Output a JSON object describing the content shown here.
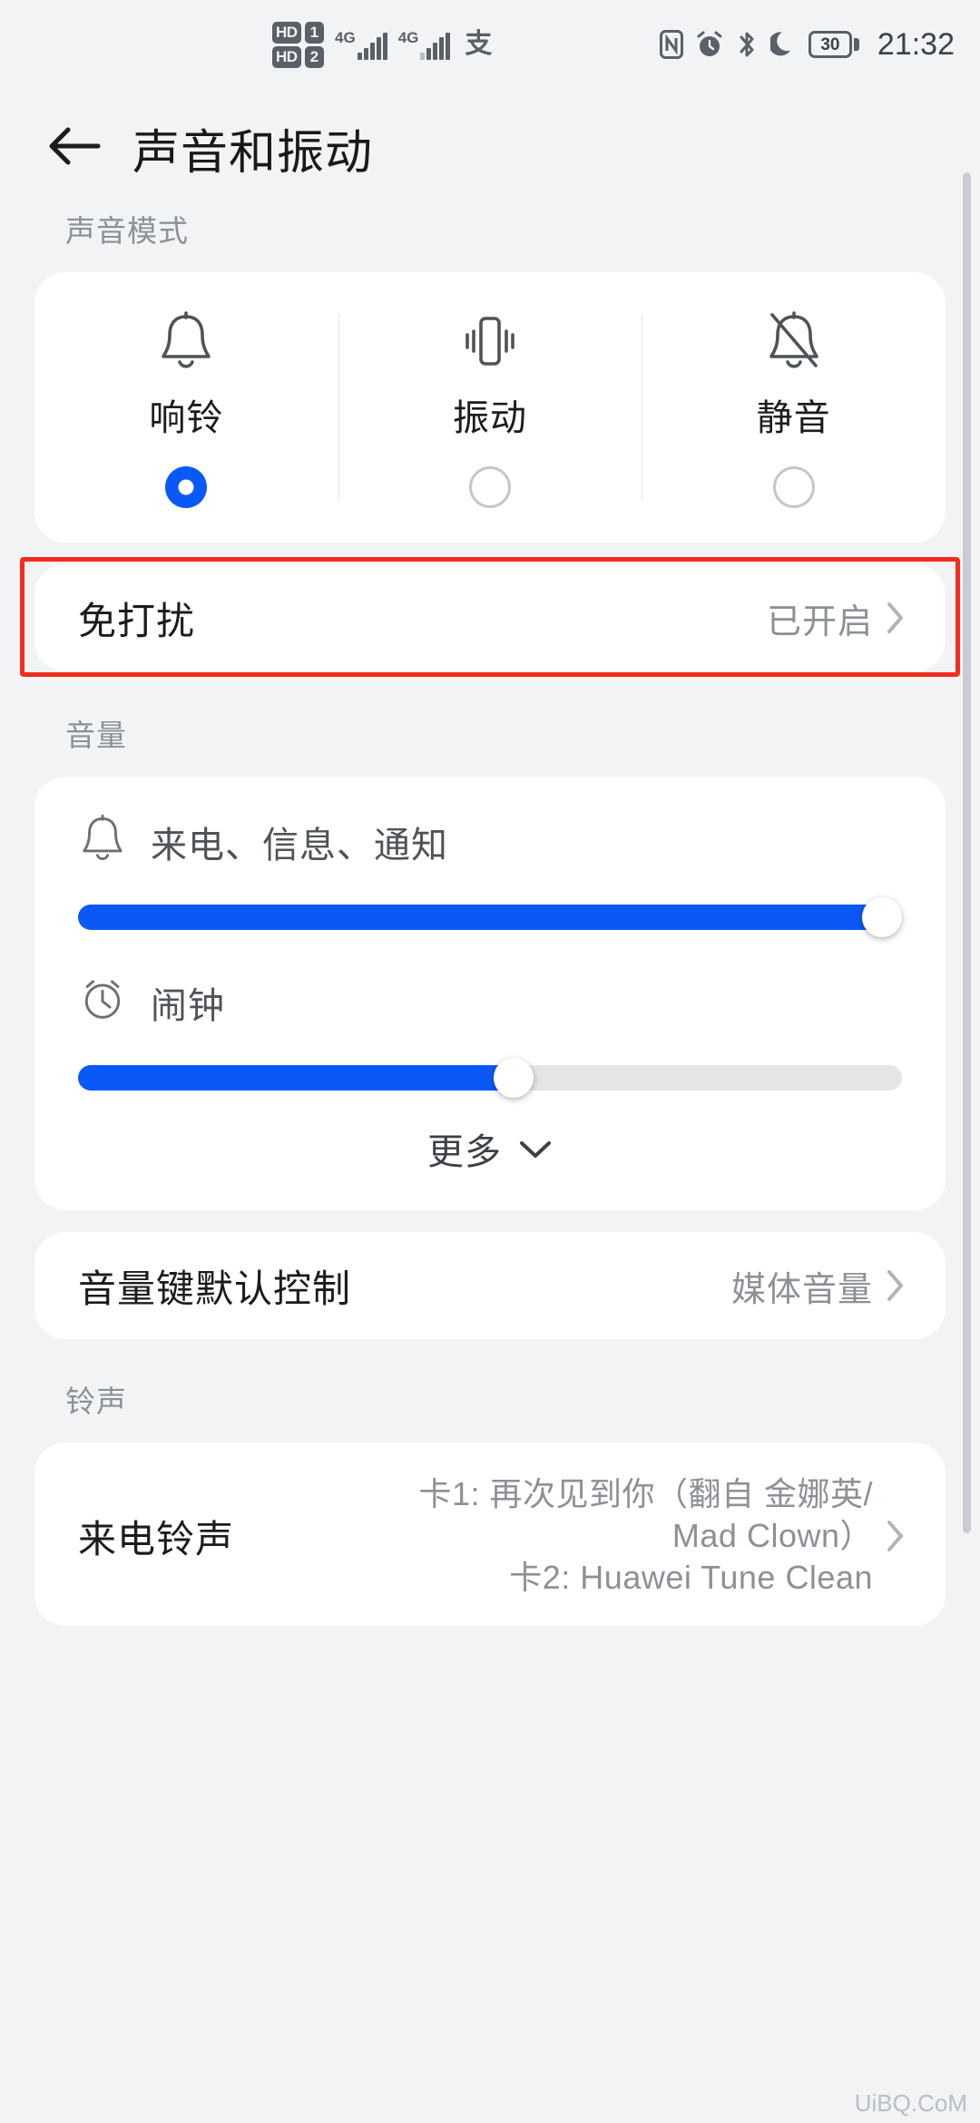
{
  "statusbar": {
    "hd1_label": "HD",
    "hd1_num": "1",
    "hd2_label": "HD",
    "hd2_num": "2",
    "network1": "4G",
    "network2": "4G",
    "alipay_glyph": "支",
    "battery_percent": "30",
    "time": "21:32",
    "icons": [
      "nfc-icon",
      "alarm-icon",
      "bluetooth-icon",
      "moon-icon",
      "battery-icon"
    ]
  },
  "header": {
    "back_icon": "back-arrow-icon",
    "title": "声音和振动"
  },
  "sound_mode": {
    "section_label": "声音模式",
    "options": [
      {
        "label": "响铃",
        "icon": "bell-icon",
        "selected": true
      },
      {
        "label": "振动",
        "icon": "vibrate-icon",
        "selected": false
      },
      {
        "label": "静音",
        "icon": "bell-muted-icon",
        "selected": false
      }
    ]
  },
  "dnd": {
    "title": "免打扰",
    "value": "已开启",
    "highlighted": true,
    "highlight_color": "#f42c1e"
  },
  "volume": {
    "section_label": "音量",
    "sliders": [
      {
        "label": "来电、信息、通知",
        "icon": "bell-icon",
        "percent": 100
      },
      {
        "label": "闹钟",
        "icon": "alarm-clock-icon",
        "percent": 53
      }
    ],
    "more_label": "更多",
    "more_icon": "chevron-down-icon"
  },
  "volume_key": {
    "title": "音量键默认控制",
    "value": "媒体音量"
  },
  "ringtone": {
    "section_label": "铃声",
    "title": "来电铃声",
    "value_lines": [
      "卡1: 再次见到你（翻自 金娜英/",
      "Mad Clown）",
      "卡2: Huawei Tune Clean"
    ]
  },
  "watermark": "UiBQ.CoM",
  "theme": {
    "accent": "#0a59f7",
    "background": "#f1f3f5",
    "card": "#ffffff",
    "text_primary": "#1a1c1e",
    "text_secondary": "#8c9196"
  }
}
